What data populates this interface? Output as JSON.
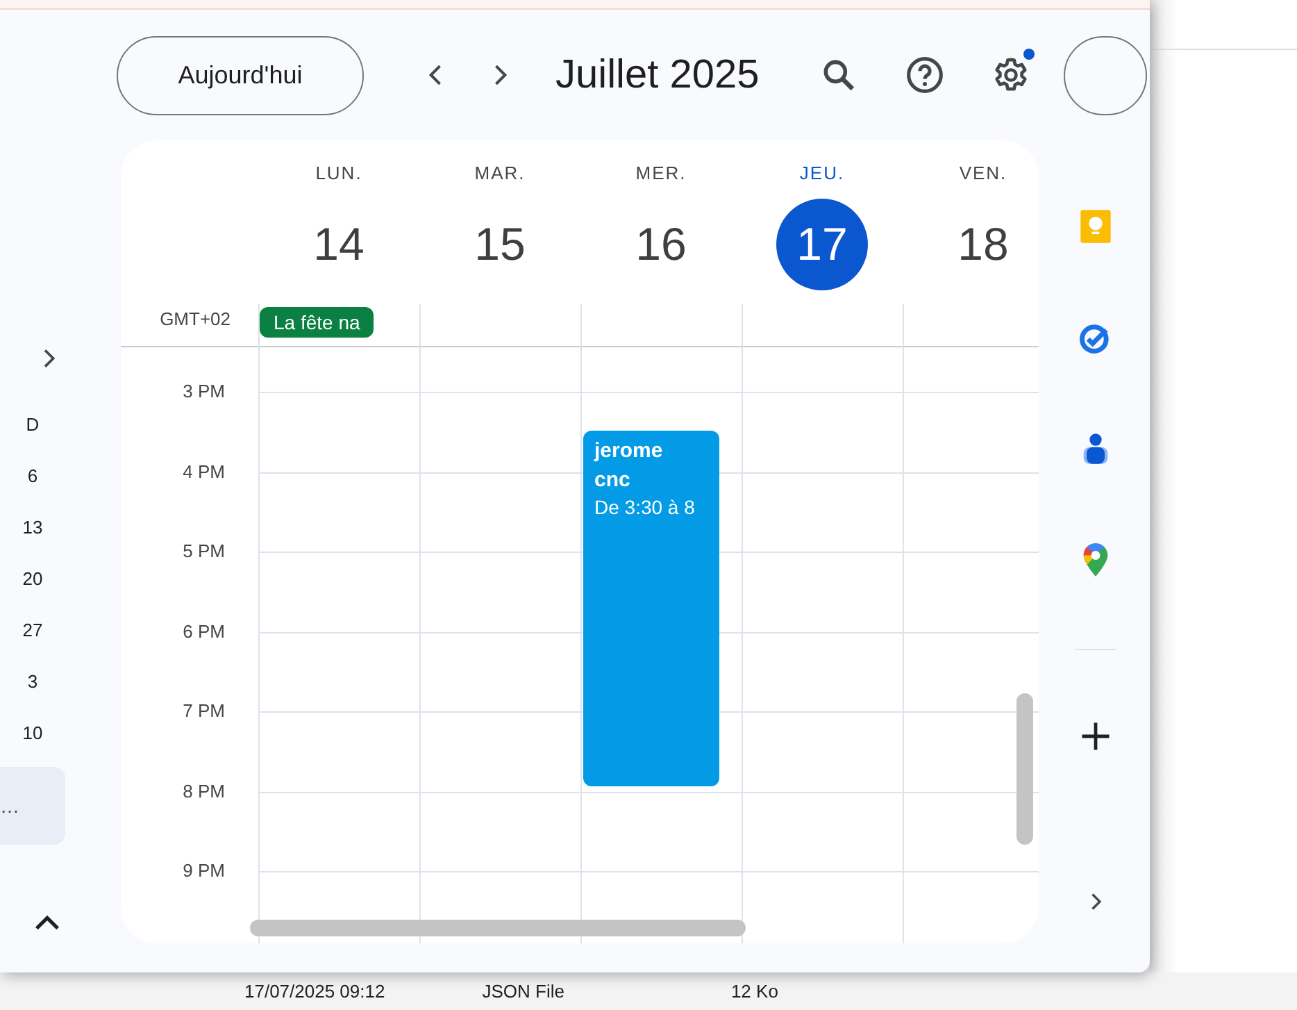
{
  "header": {
    "today_button": "Aujourd'hui",
    "title": "Juillet 2025"
  },
  "mini_calendar": {
    "items": [
      {
        "label": "D",
        "selected": false
      },
      {
        "label": "6",
        "selected": false
      },
      {
        "label": "13",
        "selected": false
      },
      {
        "label": "20",
        "selected": false
      },
      {
        "label": "27",
        "selected": false
      },
      {
        "label": "3",
        "selected": false
      },
      {
        "label": "10",
        "selected": false
      },
      {
        "label": "…",
        "selected": true
      }
    ]
  },
  "timezone": "GMT+02",
  "days": [
    {
      "weekday": "LUN.",
      "date": "14",
      "selected": false,
      "all_day_events": [
        {
          "title": "La fête na",
          "color": "#0b8043"
        }
      ]
    },
    {
      "weekday": "MAR.",
      "date": "15",
      "selected": false
    },
    {
      "weekday": "MER.",
      "date": "16",
      "selected": false,
      "events": [
        {
          "title": "jerome cnc",
          "time": "De 3:30 à 8",
          "color": "#039be5"
        }
      ]
    },
    {
      "weekday": "JEU.",
      "date": "17",
      "selected": true
    },
    {
      "weekday": "VEN.",
      "date": "18",
      "selected": false
    }
  ],
  "hours": [
    "3 PM",
    "4 PM",
    "5 PM",
    "6 PM",
    "7 PM",
    "8 PM",
    "9 PM"
  ],
  "background_file_row": {
    "modified": "17/07/2025 09:12",
    "type": "JSON File",
    "size": "12 Ko"
  }
}
